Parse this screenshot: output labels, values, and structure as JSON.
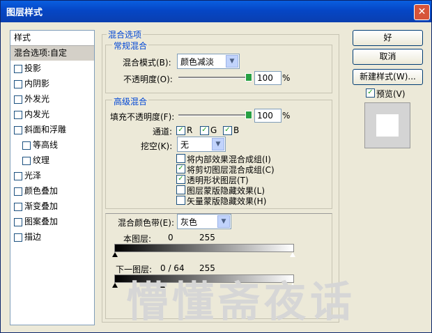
{
  "title": "图层样式",
  "left_panel": {
    "header": "样式",
    "items": [
      {
        "label": "混合选项:自定",
        "checkbox": false,
        "selected": true,
        "indent": false
      },
      {
        "label": "投影",
        "checkbox": true,
        "checked": false,
        "indent": false
      },
      {
        "label": "内阴影",
        "checkbox": true,
        "checked": false,
        "indent": false
      },
      {
        "label": "外发光",
        "checkbox": true,
        "checked": false,
        "indent": false
      },
      {
        "label": "内发光",
        "checkbox": true,
        "checked": false,
        "indent": false
      },
      {
        "label": "斜面和浮雕",
        "checkbox": true,
        "checked": false,
        "indent": false
      },
      {
        "label": "等高线",
        "checkbox": true,
        "checked": false,
        "indent": true
      },
      {
        "label": "纹理",
        "checkbox": true,
        "checked": false,
        "indent": true
      },
      {
        "label": "光泽",
        "checkbox": true,
        "checked": false,
        "indent": false
      },
      {
        "label": "颜色叠加",
        "checkbox": true,
        "checked": false,
        "indent": false
      },
      {
        "label": "渐变叠加",
        "checkbox": true,
        "checked": false,
        "indent": false
      },
      {
        "label": "图案叠加",
        "checkbox": true,
        "checked": false,
        "indent": false
      },
      {
        "label": "描边",
        "checkbox": true,
        "checked": false,
        "indent": false
      }
    ]
  },
  "blend_options": {
    "title": "混合选项",
    "general": {
      "title": "常规混合",
      "mode_label": "混合模式(B):",
      "mode_value": "颜色减淡",
      "opacity_label": "不透明度(O):",
      "opacity_value": "100",
      "opacity_unit": "%",
      "opacity_level": 1.0
    },
    "advanced": {
      "title": "高级混合",
      "fill_label": "填充不透明度(F):",
      "fill_value": "100",
      "fill_unit": "%",
      "fill_level": 1.0,
      "channels_label": "通道:",
      "channels": [
        {
          "name": "R",
          "checked": true
        },
        {
          "name": "G",
          "checked": true
        },
        {
          "name": "B",
          "checked": true
        }
      ],
      "knockout_label": "挖空(K):",
      "knockout_value": "无",
      "options": [
        {
          "label": "将内部效果混合成组(I)",
          "checked": false
        },
        {
          "label": "将剪切图层混合成组(C)",
          "checked": true
        },
        {
          "label": "透明形状图层(T)",
          "checked": true
        },
        {
          "label": "图层蒙版隐藏效果(L)",
          "checked": false
        },
        {
          "label": "矢量蒙版隐藏效果(H)",
          "checked": false
        }
      ]
    },
    "blend_if": {
      "label": "混合颜色带(E):",
      "value": "灰色",
      "this_layer": {
        "label": "本图层:",
        "low": "0",
        "high": "255"
      },
      "underlying": {
        "label": "下一图层:",
        "low": "0 / 64",
        "high": "255"
      }
    }
  },
  "buttons": {
    "ok": "好",
    "cancel": "取消",
    "new_style": "新建样式(W)...",
    "preview_label": "预览(V)",
    "preview_checked": true
  },
  "watermark": "懵懂斋夜话",
  "colors": {
    "titlebar": "#0546c5",
    "legend": "#0046d5",
    "check": "#21a121"
  }
}
